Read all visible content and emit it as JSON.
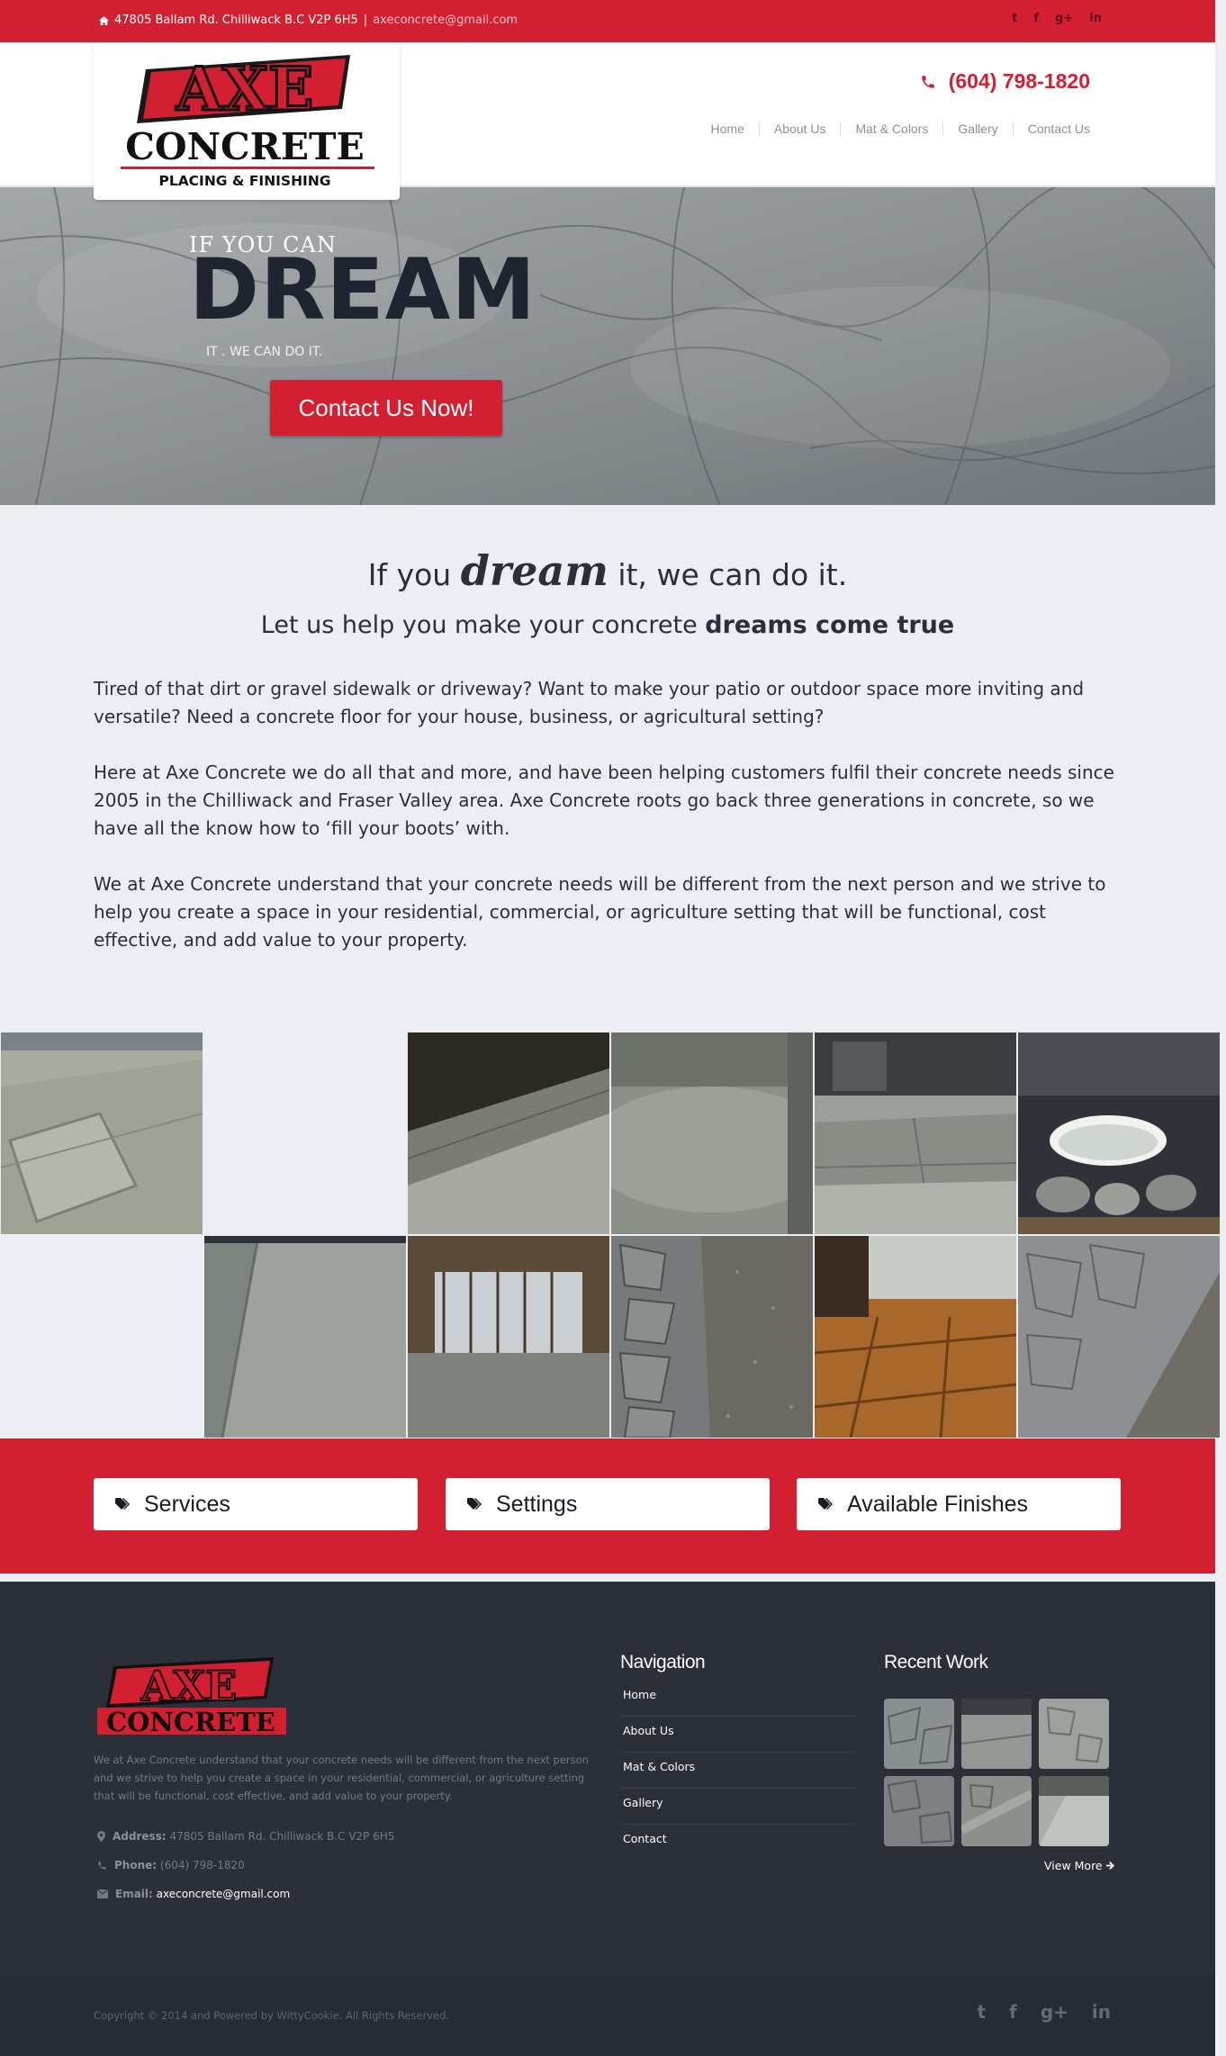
{
  "topbar": {
    "address": "47805 Ballam Rd. Chilliwack B.C V2P 6H5",
    "separator": "|",
    "email": "axeconcrete@gmail.com",
    "social": [
      "twitter-icon",
      "facebook-icon",
      "google-plus-icon",
      "linkedin-icon"
    ],
    "social_glyphs": [
      "t",
      "f",
      "g+",
      "in"
    ]
  },
  "brand": {
    "logo_word1": "AXE",
    "logo_word2": "CONCRETE",
    "logo_tagline": "PLACING & FINISHING",
    "red": "#d21f32",
    "dark": "#2a2f38"
  },
  "header": {
    "phone": "(604) 798-1820",
    "nav": [
      "Home",
      "About Us",
      "Mat & Colors",
      "Gallery",
      "Contact Us"
    ]
  },
  "hero": {
    "pre": "IF YOU CAN",
    "big": "DREAM",
    "sub": "IT . WE CAN DO IT.",
    "cta": "Contact Us Now!"
  },
  "intro": {
    "h1_before": "If you",
    "h1_emph": "dream",
    "h1_after": "it, we can do it.",
    "h2_before": "Let us help you make your concrete",
    "h2_bold": "dreams come true",
    "p1": "Tired of that dirt or gravel sidewalk or driveway? Want to make your patio or outdoor space more inviting and versatile? Need a concrete floor for your house, business, or agricultural setting?",
    "p2": "Here at Axe Concrete we do all that and more, and have been helping customers fulfil their concrete needs since 2005 in the Chilliwack and Fraser Valley area. Axe Concrete roots go back three generations in concrete, so we have all the know how to ‘fill your boots’ with.",
    "p3": "We at Axe Concrete understand that your concrete needs will be different from the next person and we strive to help you create a space in your residential, commercial, or agriculture setting that will be functional, cost effective, and add value to your property."
  },
  "strip": {
    "buttons": [
      "Services",
      "Settings",
      "Available Finishes"
    ]
  },
  "footer": {
    "logo_word1": "AXE",
    "logo_word2": "CONCRETE",
    "desc": "We at Axe Concrete understand that your concrete needs will be different from the next person and we strive to help you create a space in your residential, commercial, or agriculture setting that will be functional, cost effective, and add value to your property.",
    "address_label": "Address:",
    "address": "47805 Ballam Rd. Chilliwack B.C V2P 6H5",
    "phone_label": "Phone:",
    "phone": "(604) 798-1820",
    "email_label": "Email:",
    "email": "axeconcrete@gmail.com",
    "nav_title": "Navigation",
    "nav": [
      "Home",
      "About Us",
      "Mat & Colors",
      "Gallery",
      "Contact"
    ],
    "recent_title": "Recent Work",
    "view_more": "View More",
    "copyright": "Copyright © 2014 and Powered by WittyCookie. All Rights Reserved.",
    "social_glyphs": [
      "t",
      "f",
      "g+",
      "in"
    ]
  }
}
